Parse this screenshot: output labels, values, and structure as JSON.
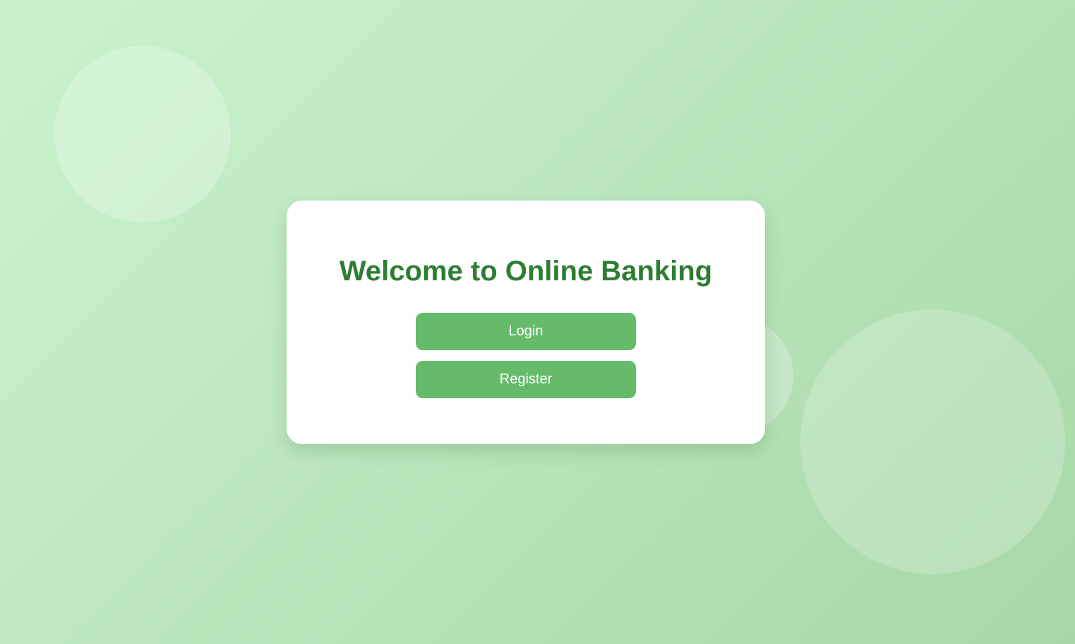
{
  "welcome": {
    "title": "Welcome to Online Banking",
    "login_label": "Login",
    "register_label": "Register"
  },
  "colors": {
    "accent": "#66bb6a",
    "title": "#2e7d32",
    "background": "#bde8c0"
  }
}
